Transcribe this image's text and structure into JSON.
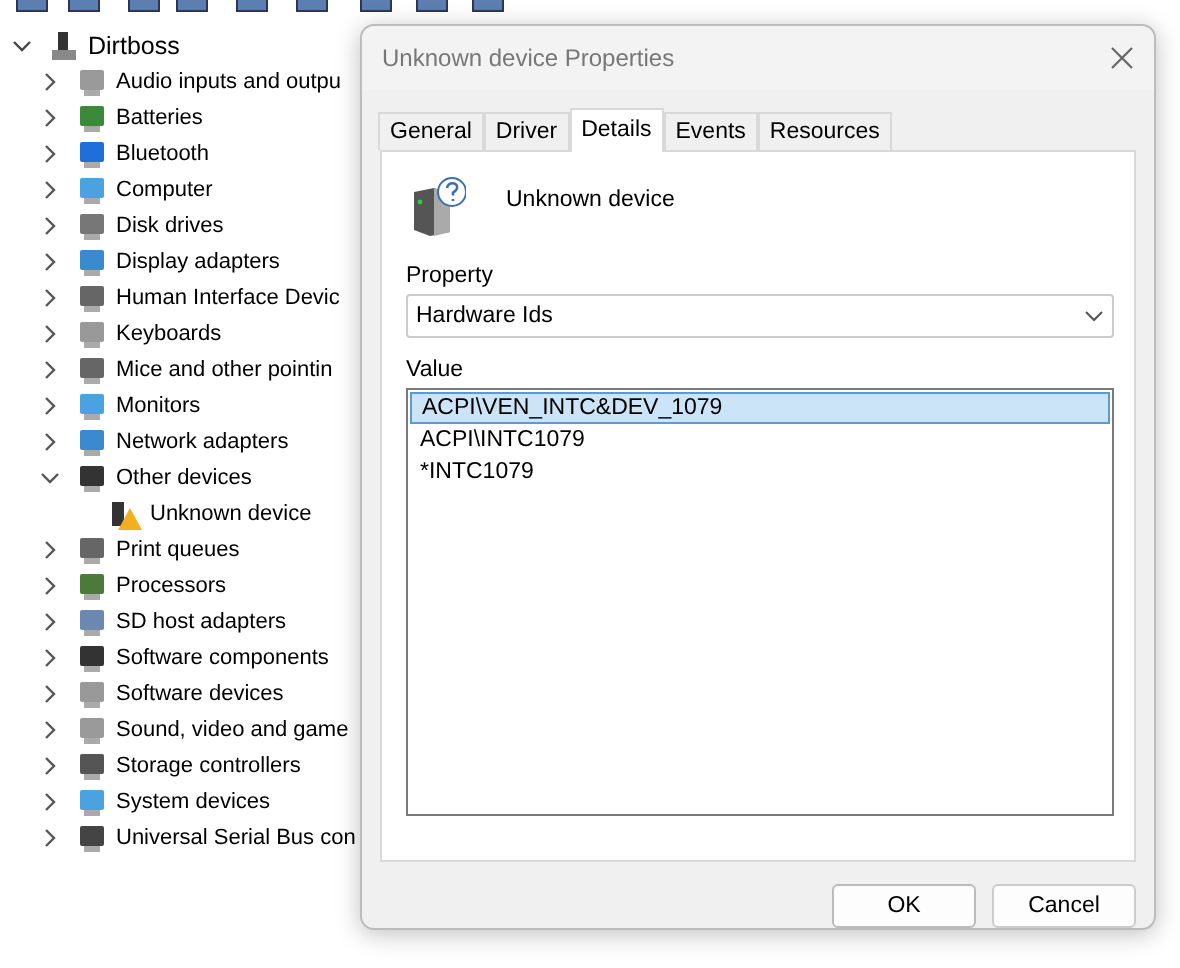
{
  "tree": {
    "label": "Dirtboss",
    "expanded": true,
    "children": [
      {
        "label": "Audio inputs and outpu",
        "expanded": false
      },
      {
        "label": "Batteries",
        "expanded": false
      },
      {
        "label": "Bluetooth",
        "expanded": false
      },
      {
        "label": "Computer",
        "expanded": false
      },
      {
        "label": "Disk drives",
        "expanded": false
      },
      {
        "label": "Display adapters",
        "expanded": false
      },
      {
        "label": "Human Interface Devic",
        "expanded": false
      },
      {
        "label": "Keyboards",
        "expanded": false
      },
      {
        "label": "Mice and other pointin",
        "expanded": false
      },
      {
        "label": "Monitors",
        "expanded": false
      },
      {
        "label": "Network adapters",
        "expanded": false
      },
      {
        "label": "Other devices",
        "expanded": true,
        "children": [
          {
            "label": "Unknown device"
          }
        ]
      },
      {
        "label": "Print queues",
        "expanded": false
      },
      {
        "label": "Processors",
        "expanded": false
      },
      {
        "label": "SD host adapters",
        "expanded": false
      },
      {
        "label": "Software components",
        "expanded": false
      },
      {
        "label": "Software devices",
        "expanded": false
      },
      {
        "label": "Sound, video and game",
        "expanded": false
      },
      {
        "label": "Storage controllers",
        "expanded": false
      },
      {
        "label": "System devices",
        "expanded": false
      },
      {
        "label": "Universal Serial Bus con",
        "expanded": false
      }
    ]
  },
  "dialog": {
    "title": "Unknown device Properties",
    "tabs": [
      {
        "label": "General",
        "selected": false
      },
      {
        "label": "Driver",
        "selected": false
      },
      {
        "label": "Details",
        "selected": true
      },
      {
        "label": "Events",
        "selected": false
      },
      {
        "label": "Resources",
        "selected": false
      }
    ],
    "device_name": "Unknown device",
    "property_label": "Property",
    "property_value": "Hardware Ids",
    "value_label": "Value",
    "values": [
      {
        "text": "ACPI\\VEN_INTC&DEV_1079",
        "selected": true
      },
      {
        "text": "ACPI\\INTC1079",
        "selected": false
      },
      {
        "text": "*INTC1079",
        "selected": false
      }
    ],
    "buttons": [
      "OK",
      "Cancel"
    ]
  }
}
